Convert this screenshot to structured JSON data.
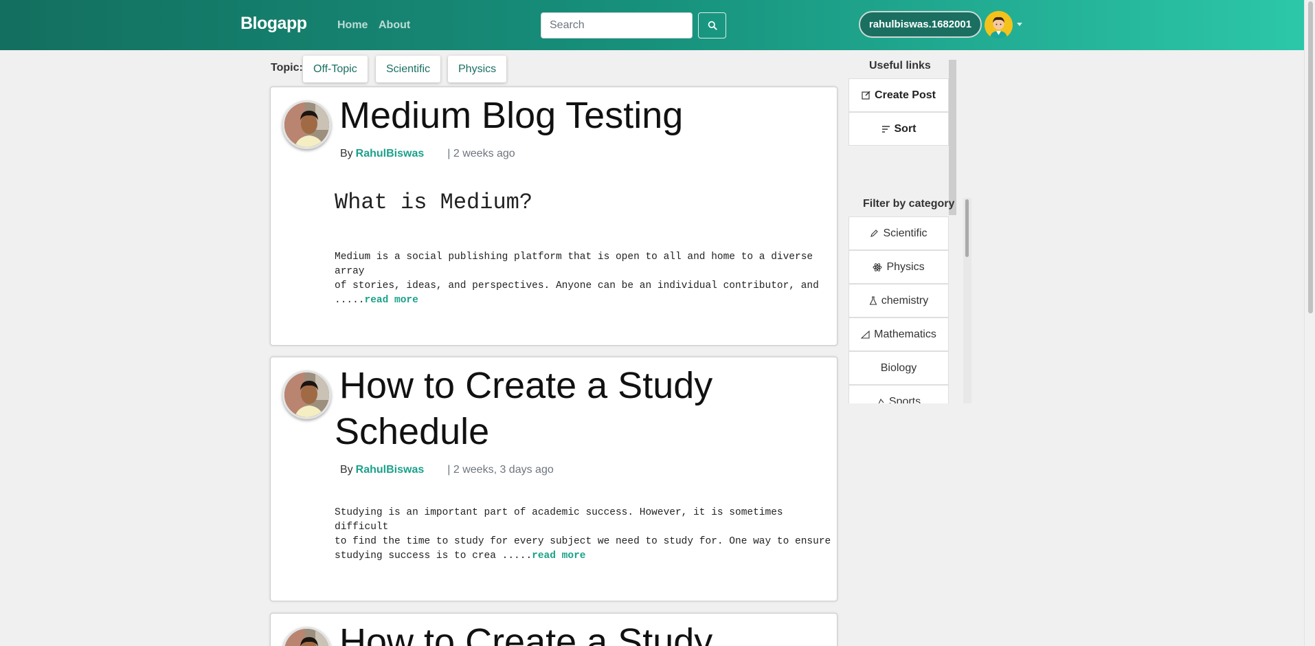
{
  "navbar": {
    "brand": "Blogapp",
    "links": [
      "Home",
      "About"
    ],
    "search_placeholder": "Search",
    "username": "rahulbiswas.1682001",
    "colors": {
      "gradient_start": "#136f5f",
      "gradient_end": "#2cc7a9"
    }
  },
  "topics": {
    "label": "Topic:",
    "items": [
      "Off-Topic",
      "Scientific",
      "Physics"
    ]
  },
  "posts": [
    {
      "title_lines": [
        "Medium Blog Testing"
      ],
      "by": "By",
      "author": "RahulBiswas",
      "date": "| 2 weeks ago",
      "heading": "What is Medium?",
      "body_lines": [
        "Medium is a social publishing platform that is open to all and home to a diverse array",
        "of stories, ideas, and perspectives. Anyone can be an individual contributor, and",
        "....."
      ],
      "read_more": "read more"
    },
    {
      "title_lines": [
        "How to Create a Study",
        "Schedule"
      ],
      "by": "By",
      "author": "RahulBiswas",
      "date": "| 2 weeks, 3 days ago",
      "heading": "",
      "body_lines": [
        "Studying is an important part of academic success. However, it is sometimes difficult",
        "to find the time to study for every subject we need to study for. One way to ensure",
        "studying success is to crea ....."
      ],
      "read_more": "read more"
    },
    {
      "title_lines": [
        "How to Create a Study"
      ]
    }
  ],
  "sidebar": {
    "useful_links_title": "Useful links",
    "useful_links": [
      {
        "label": "Create Post",
        "icon": "edit-icon"
      },
      {
        "label": "Sort",
        "icon": "sort-icon"
      }
    ],
    "filter_title": "Filter by category",
    "categories": [
      {
        "label": "Scientific",
        "icon": "pen-icon"
      },
      {
        "label": "Physics",
        "icon": "atom-icon"
      },
      {
        "label": "chemistry",
        "icon": "flask-icon"
      },
      {
        "label": "Mathematics",
        "icon": "triangle-icon"
      },
      {
        "label": "Biology",
        "icon": ""
      },
      {
        "label": "Sports",
        "icon": "sports-icon"
      }
    ]
  }
}
